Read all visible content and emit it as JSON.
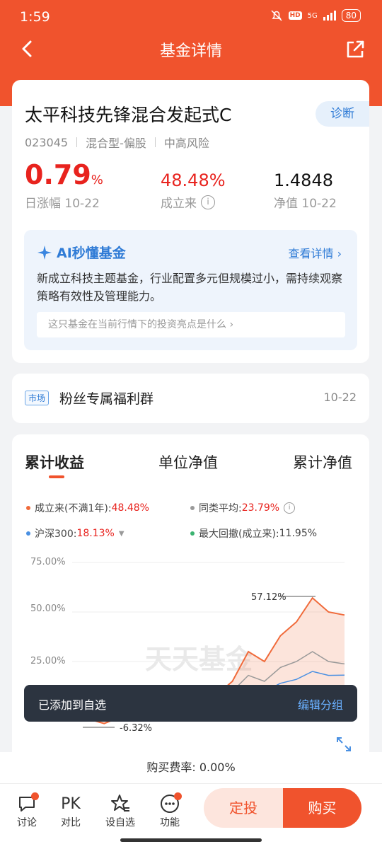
{
  "status": {
    "time": "1:59",
    "network": "5G",
    "battery": "80",
    "hd": "HD"
  },
  "nav": {
    "title": "基金详情"
  },
  "fund": {
    "name": "太平科技先锋混合发起式C",
    "diagnose_label": "诊断",
    "code": "023045",
    "type": "混合型-偏股",
    "risk": "中高风险",
    "daily_change_value": "0.79",
    "daily_change_unit": "%",
    "daily_change_label": "日涨幅 10-22",
    "since_inception_value": "48.48%",
    "since_inception_label": "成立来",
    "nav_value": "1.4848",
    "nav_label": "净值 10-22"
  },
  "ai": {
    "title": "AI秒懂基金",
    "link": "查看详情",
    "summary": "新成立科技主题基金，行业配置多元但规模过小，需持续观察策略有效性及管理能力。",
    "question": "这只基金在当前行情下的投资亮点是什么"
  },
  "group": {
    "tag": "市场",
    "title": "粉丝专属福利群",
    "date": "10-22"
  },
  "chart_tabs": [
    "累计收益",
    "单位净值",
    "累计净值"
  ],
  "legend": {
    "fund_label": "成立来(不满1年):",
    "fund_value": "48.48%",
    "peer_label": "同类平均:",
    "peer_value": "23.79%",
    "index_label": "沪深300:",
    "index_value": "18.13%",
    "drawdown_label": "最大回撤(成立来):",
    "drawdown_value": "11.95%"
  },
  "colors": {
    "brand": "#f0532d",
    "fund": "#f06a3a",
    "peer": "#999999",
    "index": "#4a90e2",
    "drawdown": "#3cb371"
  },
  "chart_data": {
    "type": "line",
    "yticks": [
      "75.00%",
      "50.00%",
      "25.00%"
    ],
    "annotations": [
      "57.12%",
      "-6.32%"
    ],
    "watermark": "天天基金",
    "series": [
      {
        "name": "成立来(不满1年)",
        "values": [
          0,
          -4,
          -6.32,
          -3,
          -2,
          0,
          2,
          3,
          5,
          8,
          15,
          30,
          25,
          38,
          45,
          57.12,
          50,
          48.48
        ]
      },
      {
        "name": "同类平均",
        "values": [
          0,
          -3,
          -5,
          -3,
          -2,
          -1,
          0,
          1,
          3,
          5,
          10,
          18,
          15,
          22,
          25,
          30,
          25,
          23.79
        ]
      },
      {
        "name": "沪深300",
        "values": [
          0,
          -2,
          -4,
          -3,
          -2,
          -1,
          0,
          1,
          2,
          3,
          6,
          12,
          10,
          14,
          16,
          20,
          18,
          18.13
        ]
      }
    ],
    "ylim": [
      -15,
      75
    ]
  },
  "toast": {
    "text": "已添加到自选",
    "action": "编辑分组"
  },
  "fee": "购买费率: 0.00%",
  "bottom": {
    "discuss": "讨论",
    "pk_icon": "PK",
    "compare": "对比",
    "add_fav": "设自选",
    "features": "功能",
    "sip": "定投",
    "buy": "购买"
  }
}
